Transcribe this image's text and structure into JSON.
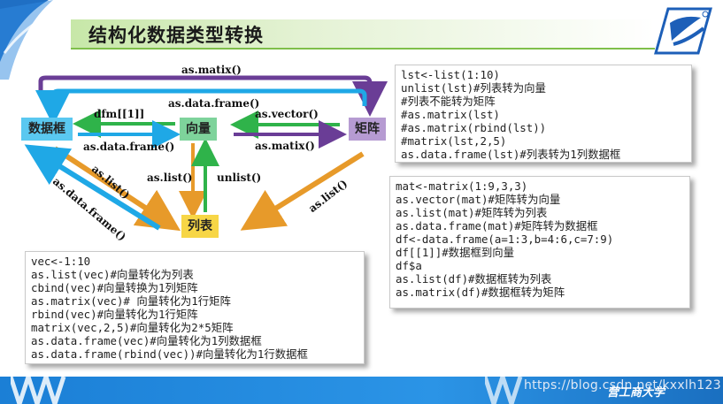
{
  "title": "结构化数据类型转换",
  "nodes": {
    "data_frame": "数据框",
    "vector": "向量",
    "matrix": "矩阵",
    "list": "列表"
  },
  "arrows": {
    "matrix_top": "as.matix()",
    "dataframe_top": "as.data.frame()",
    "dfm": "dfm[[1]]",
    "vec_to_df": "as.data.frame()",
    "mat_to_vec": "as.vector()",
    "vec_to_mat": "as.matix()",
    "vec_to_list": "as.list()",
    "list_to_vec": "unlist()",
    "df_to_list": "as.list()",
    "list_to_df": "as.data.frame()",
    "mat_to_list": "as.list()"
  },
  "panel1": [
    "lst<-list(1:10)",
    "unlist(lst)#列表转为向量",
    "#列表不能转为矩阵",
    "#as.matrix(lst)",
    "#as.matrix(rbind(lst))",
    "#matrix(lst,2,5)",
    "as.data.frame(lst)#列表转为1列数据框"
  ],
  "panel2": [
    "mat<-matrix(1:9,3,3)",
    "as.vector(mat)#矩阵转为向量",
    "as.list(mat)#矩阵转为列表",
    "as.data.frame(mat)#矩阵转为数据框",
    "",
    "df<-data.frame(a=1:3,b=4:6,c=7:9)",
    "df[[1]]#数据框到向量",
    "df$a",
    "as.list(df)#数据框转为列表",
    "as.matrix(df)#数据框转为矩阵"
  ],
  "panel3": [
    "vec<-1:10",
    "as.list(vec)#向量转化为列表",
    "cbind(vec)#向量转换为1列矩阵",
    "as.matrix(vec)# 向量转化为1行矩阵",
    "rbind(vec)#向量转化为1行矩阵",
    "matrix(vec,2,5)#向量转化为2*5矩阵",
    "as.data.frame(vec)#向量转化为1列数据框",
    "as.data.frame(rbind(vec))#向量转化为1行数据框"
  ],
  "footer": {
    "school": "营工商大学",
    "watermark": "https://blog.csdn.net/kxxlh123"
  },
  "colors": {
    "purple": "#6a3d96",
    "blue": "#1fa8e6",
    "green": "#2fb34a",
    "orange": "#e79a2a"
  }
}
